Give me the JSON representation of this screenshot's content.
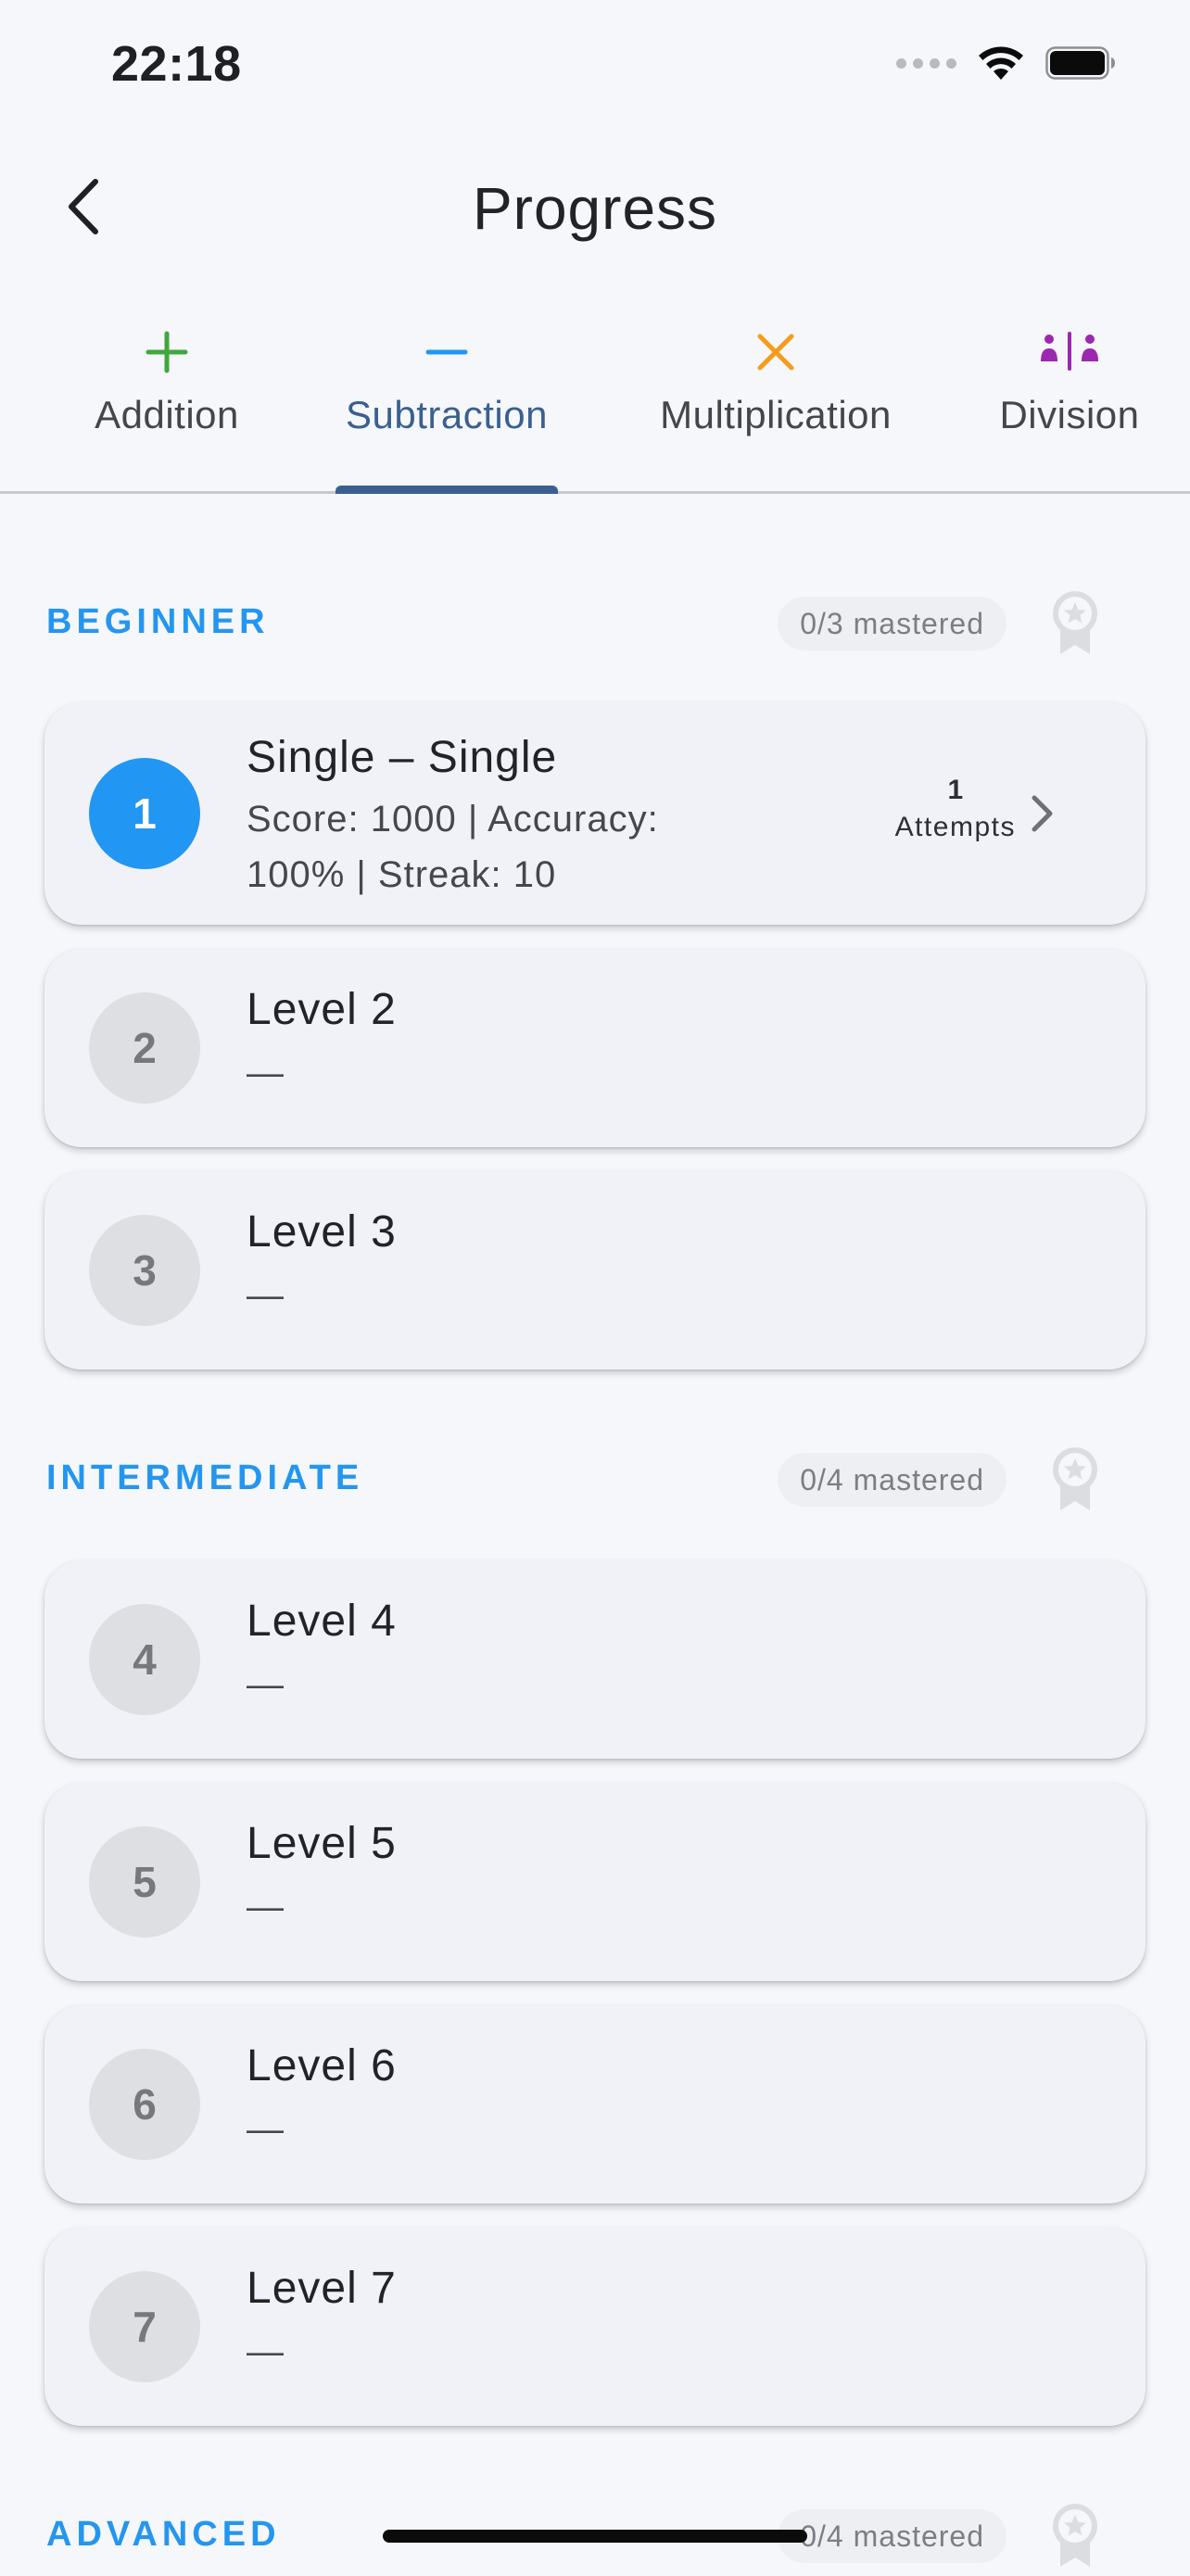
{
  "status_bar": {
    "time": "22:18"
  },
  "header": {
    "title": "Progress"
  },
  "tabs": [
    {
      "label": "Addition",
      "icon": "plus-icon",
      "color": "#3fa83c"
    },
    {
      "label": "Subtraction",
      "icon": "minus-icon",
      "color": "#2196f3",
      "active": true
    },
    {
      "label": "Multiplication",
      "icon": "times-icon",
      "color": "#f59c1b"
    },
    {
      "label": "Division",
      "icon": "division-icon",
      "color": "#9c27b0"
    }
  ],
  "sections": [
    {
      "title": "BEGINNER",
      "mastered": "0/3 mastered",
      "levels": [
        {
          "number": "1",
          "title": "Single – Single",
          "subtitle": "Score: 1000  |  Accuracy: 100%  |  Streak: 10",
          "attempts_count": "1",
          "attempts_label": "Attempts",
          "active": true
        },
        {
          "number": "2",
          "title": "Level 2",
          "subtitle": "—"
        },
        {
          "number": "3",
          "title": "Level 3",
          "subtitle": "—"
        }
      ]
    },
    {
      "title": "INTERMEDIATE",
      "mastered": "0/4 mastered",
      "levels": [
        {
          "number": "4",
          "title": "Level 4",
          "subtitle": "—"
        },
        {
          "number": "5",
          "title": "Level 5",
          "subtitle": "—"
        },
        {
          "number": "6",
          "title": "Level 6",
          "subtitle": "—"
        },
        {
          "number": "7",
          "title": "Level 7",
          "subtitle": "—"
        }
      ]
    },
    {
      "title": "ADVANCED",
      "mastered": "0/4 mastered",
      "levels": []
    }
  ],
  "colors": {
    "accent": "#2196f3",
    "section_title": "#2496f0",
    "tab_indicator": "#3a6090",
    "background": "#f6f7fb"
  }
}
